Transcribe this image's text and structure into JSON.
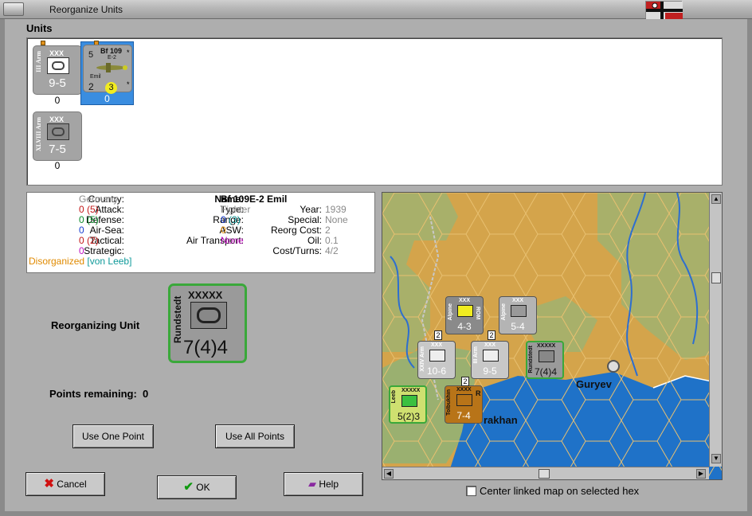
{
  "window": {
    "title": "Reorganize Units"
  },
  "units_section": {
    "label": "Units"
  },
  "units": [
    {
      "vlabel": "III Arm",
      "size": "XXX",
      "strength": "9-5",
      "count": "0"
    },
    {
      "name": "Bf 109",
      "variant": "E-2",
      "nick": "Emil",
      "top_left": "5",
      "bottom_left": "2",
      "badge": "3",
      "count": "0"
    },
    {
      "vlabel": "XLVIII Arm",
      "size": "XXX",
      "strength": "7-5",
      "count": "0"
    }
  ],
  "info": {
    "country_label": "Country:",
    "country": "Germany",
    "attack_label": "Attack:",
    "attack": "0",
    "attack_paren": "(5)",
    "defense_label": "Defense:",
    "defense": "0",
    "defense_paren": "(5)",
    "airsea_label": "Air-Sea:",
    "airsea": "0",
    "tactical_label": "Tactical:",
    "tactical": "0",
    "tactical_paren": "(2)",
    "strategic_label": "Strategic:",
    "strategic": "0",
    "status": "Disorganized",
    "leader": "[von Leeb]",
    "name_label": "Name:",
    "name": "Bf 109E-2 Emil",
    "type_label": "Type:",
    "type": "Fighter",
    "range_label": "Range:",
    "range": "0",
    "range_paren": "(3)",
    "asw_label": "ASW:",
    "asw": "0",
    "airtransport_label": "Air Transport:",
    "airtransport": "None",
    "year_label": "Year:",
    "year": "1939",
    "special_label": "Special:",
    "special": "None",
    "reorgcost_label": "Reorg Cost:",
    "reorgcost": "2",
    "oil_label": "Oil:",
    "oil": "0.1",
    "costturns_label": "Cost/Turns:",
    "costturns": "4/2"
  },
  "reorganizing": {
    "label": "Reorganizing Unit",
    "vlabel": "Rundstedt",
    "size": "XXXXX",
    "strength": "7(4)4"
  },
  "points": {
    "label": "Points remaining:",
    "value": "0"
  },
  "buttons": {
    "use_one": "Use One Point",
    "use_all": "Use All Points",
    "cancel": "Cancel",
    "ok": "OK",
    "help": "Help"
  },
  "map": {
    "cities": [
      "Guryev",
      "rakhan"
    ],
    "units": [
      {
        "vlabel": "Alpine",
        "size": "XXX",
        "strength": "4-3",
        "tag": "ROM"
      },
      {
        "vlabel": "Alpine",
        "size": "XXX",
        "strength": "5-4"
      },
      {
        "vlabel": "XXIV Arm",
        "size": "XXX",
        "strength": "10-6",
        "stack": "2"
      },
      {
        "vlabel": "III Arm",
        "size": "XXX",
        "strength": "9-5",
        "stack": "2"
      },
      {
        "vlabel": "Rundstedt",
        "size": "XXXXX",
        "strength": "7(4)4"
      },
      {
        "vlabel": "Leeb",
        "size": "XXXXX",
        "strength": "5(2)3"
      },
      {
        "vlabel": "Tolbukhin",
        "size": "XXXX",
        "strength": "7-4",
        "tag": "R",
        "stack": "2"
      }
    ]
  },
  "center_checkbox": {
    "label": "Center linked map on selected hex",
    "checked": false
  },
  "colors": {
    "selection": "#3a8de0",
    "panel": "#aeaeae",
    "sea": "#1f72c8",
    "desert": "#d4a44b",
    "green_border": "#3aa83a"
  }
}
